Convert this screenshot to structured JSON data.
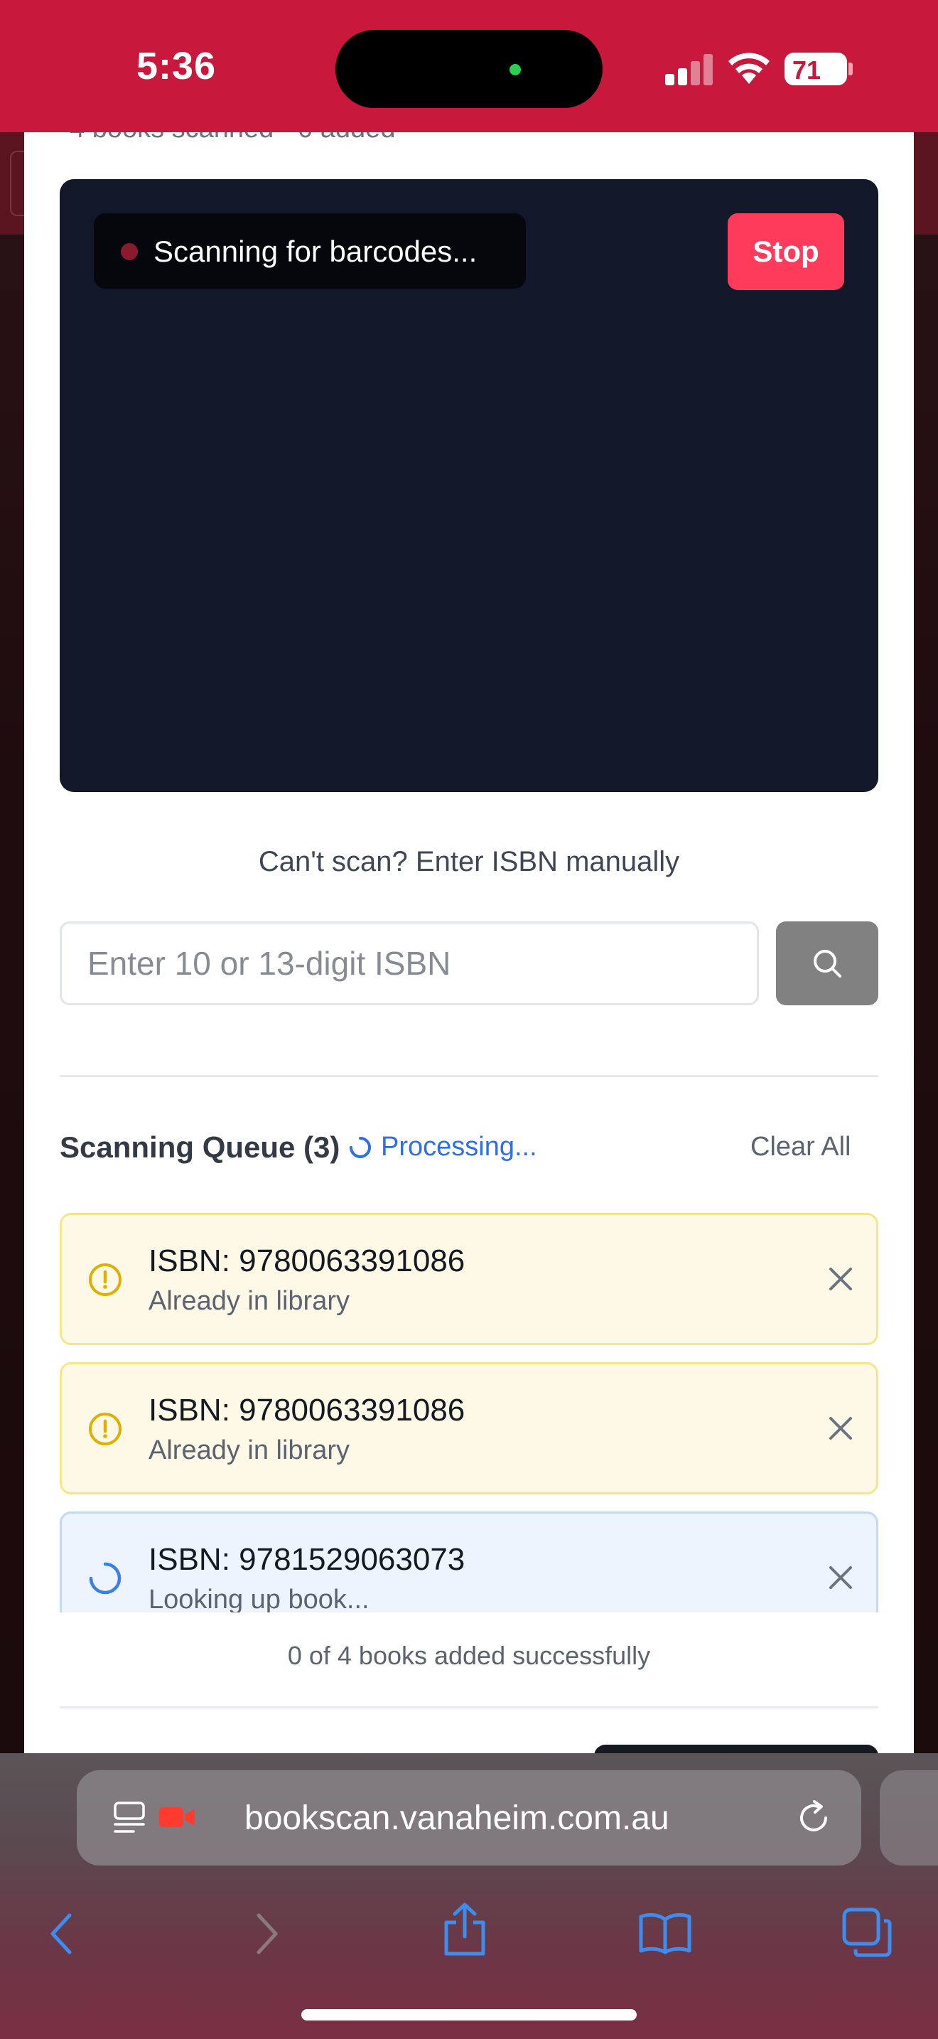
{
  "status_bar": {
    "time": "5:36",
    "battery": "71",
    "battery_level": 0.71,
    "signal_bars": 2
  },
  "modal": {
    "peek_text": "4 books scanned · 0 added",
    "camera": {
      "status_text": "Scanning for barcodes...",
      "stop_label": "Stop"
    },
    "manual_entry": {
      "label": "Can't scan? Enter ISBN manually",
      "placeholder": "Enter 10 or 13-digit ISBN",
      "value": ""
    },
    "queue": {
      "title": "Scanning Queue (3)",
      "processing_label": "Processing...",
      "clear_all_label": "Clear All",
      "items": [
        {
          "isbn": "ISBN: 9780063391086",
          "status": "Already in library",
          "state": "warning"
        },
        {
          "isbn": "ISBN: 9780063391086",
          "status": "Already in library",
          "state": "warning"
        },
        {
          "isbn": "ISBN: 9781529063073",
          "status": "Looking up book...",
          "state": "loading"
        }
      ]
    },
    "summary": "0 of 4 books added successfully"
  },
  "browser": {
    "url": "bookscan.vanaheim.com.au"
  },
  "colors": {
    "brand_red": "#c8193d",
    "stop_button": "#ff3b5c",
    "camera_bg": "#121829",
    "warning_bg": "#fdf9e6",
    "warning_icon": "#e0b000",
    "info_bg": "#edf4fd",
    "link_blue": "#2f6fe0",
    "browser_blue": "#3d8cf0"
  },
  "icons": {
    "search": "search-icon",
    "warning": "alert-circle-icon",
    "loading": "spinner-icon",
    "close": "close-icon",
    "back": "chevron-left-icon",
    "forward": "chevron-right-icon",
    "share": "share-icon",
    "bookmarks": "book-icon",
    "tabs": "tabs-icon",
    "reload": "reload-icon"
  }
}
